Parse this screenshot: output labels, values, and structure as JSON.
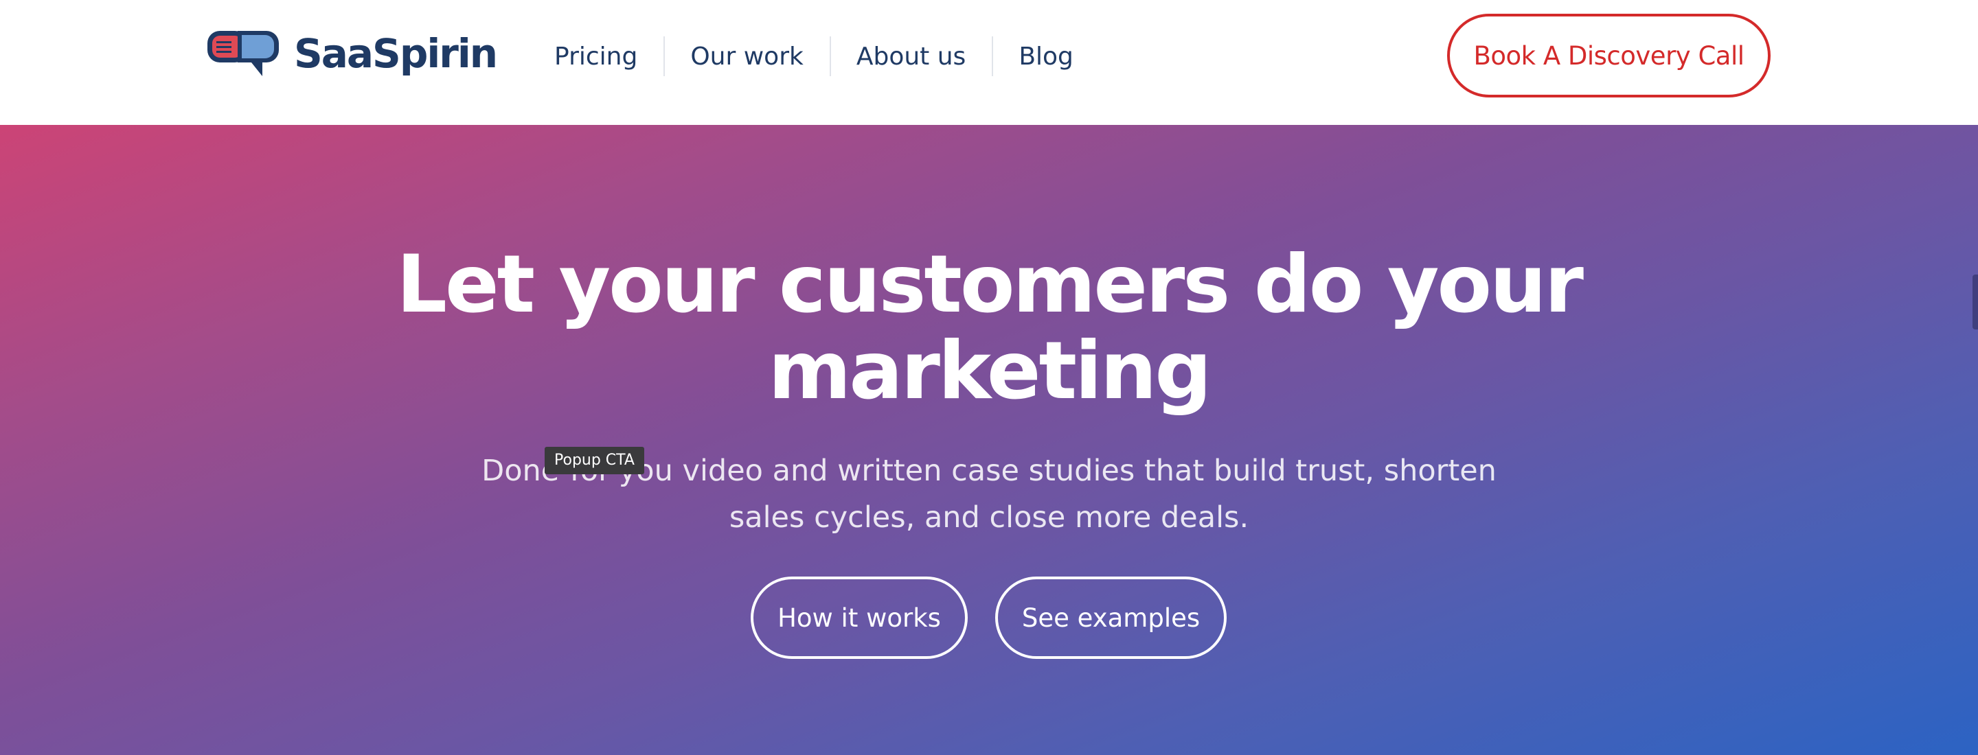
{
  "brand": {
    "name": "SaaSpirin",
    "logo_icon": "speech-bubble-logo-icon",
    "colors": {
      "navy": "#1f3a64",
      "accent_red": "#d42a2a",
      "logo_red": "#e04a55"
    }
  },
  "nav": {
    "links": [
      {
        "label": "Pricing"
      },
      {
        "label": "Our work"
      },
      {
        "label": "About us"
      },
      {
        "label": "Blog"
      }
    ],
    "cta_label": "Book A Discovery Call"
  },
  "hero": {
    "title": "Let your customers do your marketing",
    "subtitle": "Done-for-you video and written case studies that build trust, shorten sales cycles, and close more deals.",
    "tooltip": "Popup CTA",
    "buttons": [
      {
        "label": "How it works"
      },
      {
        "label": "See examples"
      }
    ],
    "gradient": {
      "start": "#cc4476",
      "mid": "#7f4f98",
      "end": "#2c63c3"
    }
  }
}
